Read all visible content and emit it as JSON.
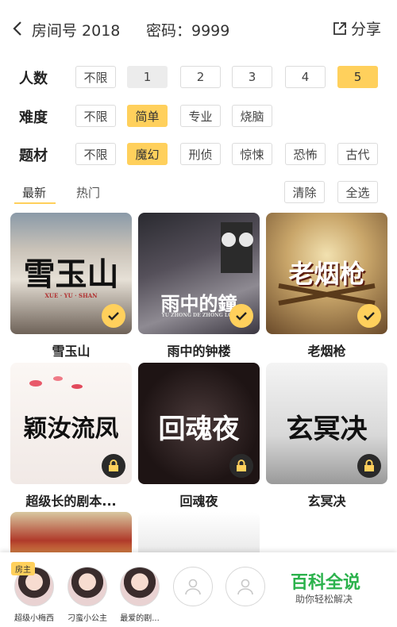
{
  "header": {
    "room_label": "房间号  2018",
    "password_label": "密码：9999",
    "share_label": "分享"
  },
  "filters": {
    "people": {
      "label": "人数",
      "options": [
        "不限",
        "1",
        "2",
        "3",
        "4",
        "5"
      ],
      "selected": "5"
    },
    "difficulty": {
      "label": "难度",
      "options": [
        "不限",
        "简单",
        "专业",
        "烧脑"
      ],
      "selected": "简单"
    },
    "theme": {
      "label": "题材",
      "options": [
        "不限",
        "魔幻",
        "刑侦",
        "惊悚",
        "恐怖",
        "古代"
      ],
      "selected": "魔幻"
    }
  },
  "tabs": {
    "latest": "最新",
    "hot": "热门"
  },
  "actions": {
    "clear": "清除",
    "select_all": "全选"
  },
  "scripts": [
    {
      "name": "雪玉山",
      "cover_text": "雪玉山",
      "cover_sub": "XUE · YU · SHAN",
      "status": "selected"
    },
    {
      "name": "雨中的钟楼",
      "cover_text": "雨中的鐘",
      "cover_sub": "YU ZHONG DE ZHONG LOU",
      "status": "selected"
    },
    {
      "name": "老烟枪",
      "cover_text": "老烟枪",
      "cover_sub": "",
      "status": "selected"
    },
    {
      "name": "超级长的剧本...",
      "cover_text": "颖汝流凤",
      "cover_sub": "",
      "status": "locked"
    },
    {
      "name": "回魂夜",
      "cover_text": "回魂夜",
      "cover_sub": "",
      "status": "locked"
    },
    {
      "name": "玄冥决",
      "cover_text": "玄冥决",
      "cover_sub": "",
      "status": "locked"
    }
  ],
  "players": [
    {
      "name": "超级小梅西",
      "is_host": true,
      "host_label": "房主"
    },
    {
      "name": "刁蛮小公主",
      "is_host": false
    },
    {
      "name": "最爱的剧...",
      "is_host": false
    }
  ],
  "watermark": {
    "title": "百科全说",
    "subtitle": "助你轻松解决"
  },
  "colors": {
    "accent": "#ffd05c",
    "watermark_green": "#2bb24c"
  }
}
